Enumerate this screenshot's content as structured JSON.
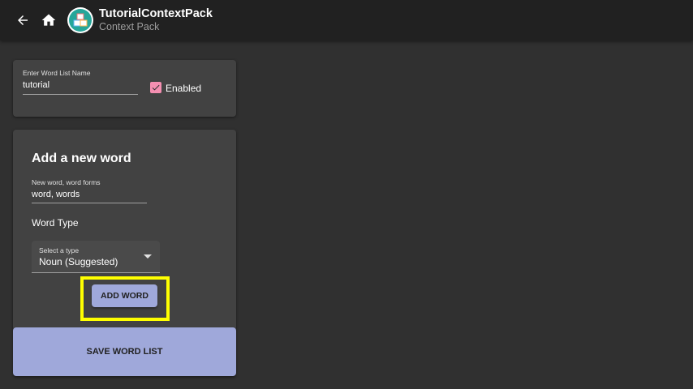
{
  "toolbar": {
    "title": "TutorialContextPack",
    "subtitle": "Context Pack",
    "back_icon": "arrow-back-icon",
    "home_icon": "home-icon",
    "logo_icon": "word-blocks-logo-icon"
  },
  "word_list": {
    "name_label": "Enter Word List Name",
    "name_value": "tutorial",
    "enabled_label": "Enabled",
    "enabled_checked": true
  },
  "add_word": {
    "heading": "Add a new word",
    "word_label": "New word, word forms",
    "word_value": "word, words",
    "type_heading": "Word Type",
    "select_label": "Select a type",
    "select_value": "Noun (Suggested)",
    "add_button": "ADD WORD"
  },
  "save_button": "SAVE WORD LIST",
  "colors": {
    "background": "#303030",
    "toolbar": "#212121",
    "card": "#424242",
    "accent_button": "#9fa8da",
    "checkbox": "#f48fb1",
    "highlight": "#ffff00"
  }
}
